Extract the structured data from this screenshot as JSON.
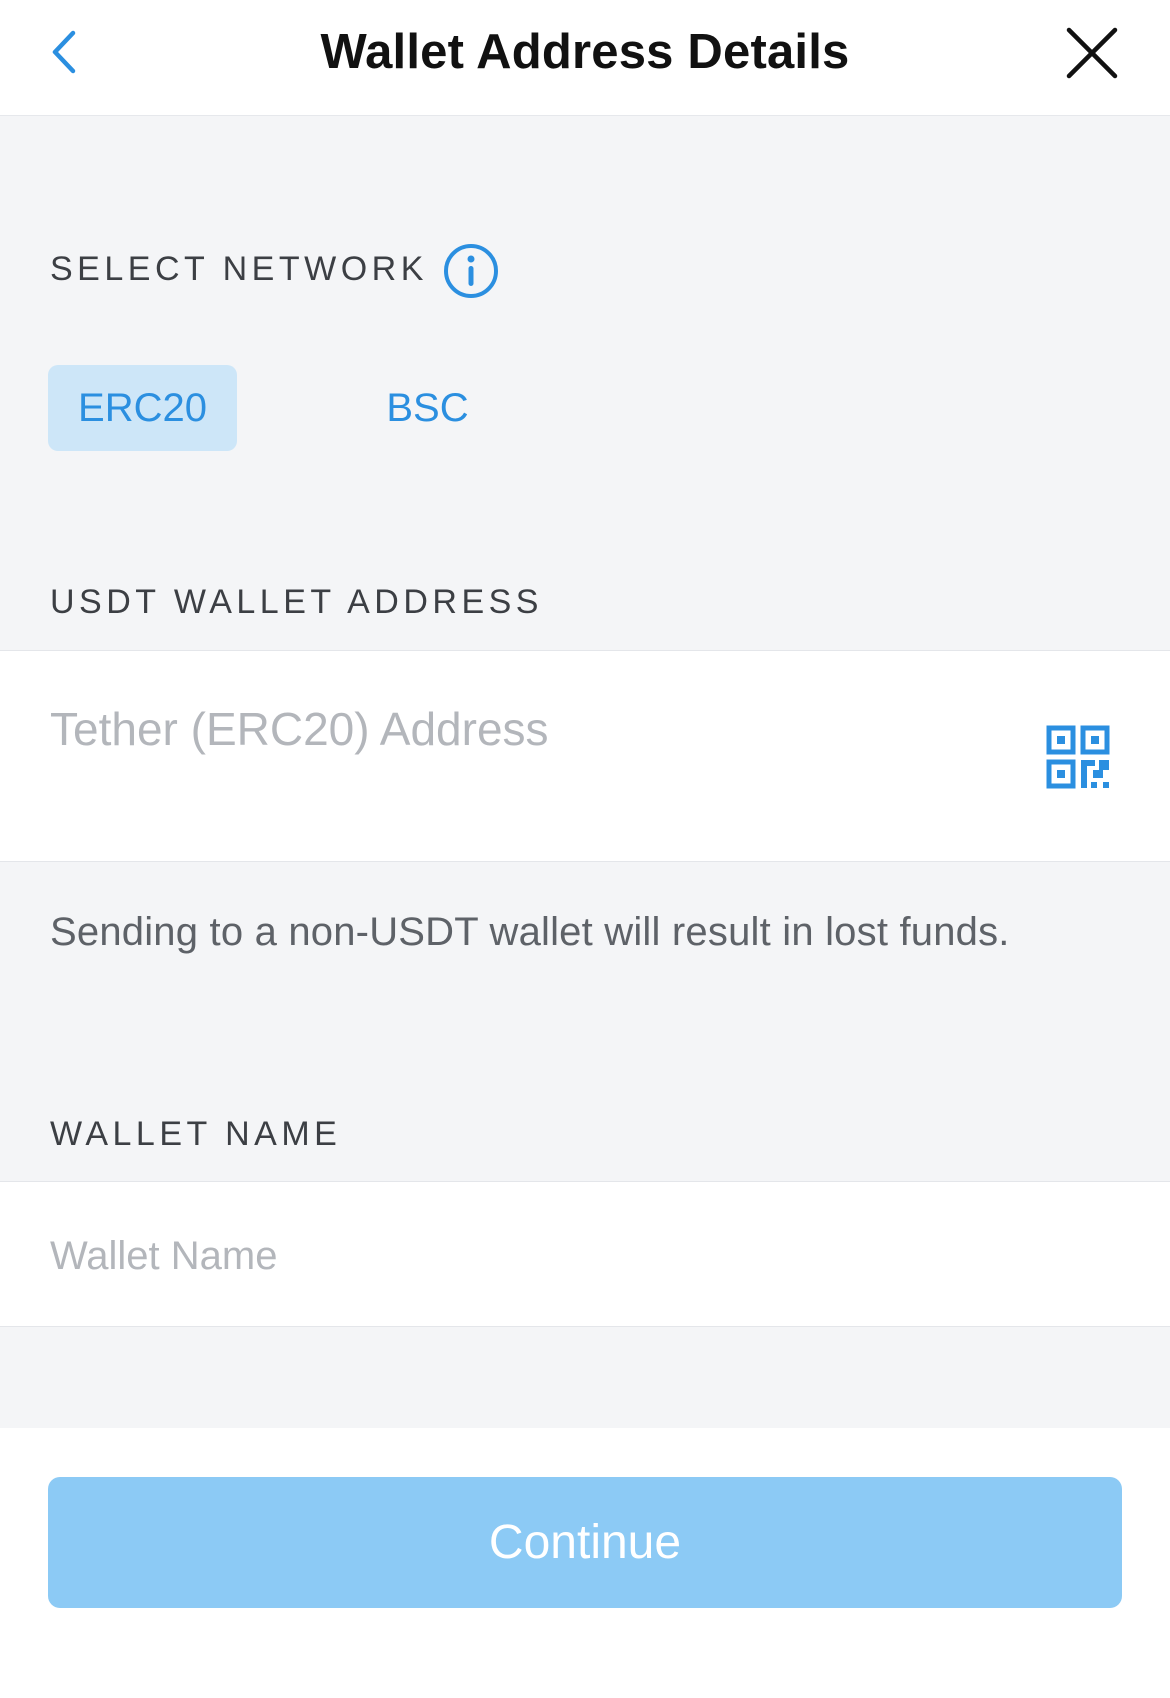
{
  "header": {
    "title": "Wallet Address Details",
    "back_icon": "chevron-left-icon",
    "close_icon": "close-icon"
  },
  "network": {
    "label": "SELECT NETWORK",
    "info_icon": "info-icon",
    "options": [
      {
        "label": "ERC20",
        "selected": true
      },
      {
        "label": "BSC",
        "selected": false
      }
    ]
  },
  "address": {
    "label": "USDT WALLET ADDRESS",
    "value": "",
    "placeholder": "Tether (ERC20) Address",
    "qr_icon": "qr-code-icon",
    "warning": "Sending to a non-USDT wallet will result in lost funds."
  },
  "wallet_name": {
    "label": "WALLET NAME",
    "value": "",
    "placeholder": "Wallet Name"
  },
  "continue_label": "Continue",
  "colors": {
    "accent": "#2B8FE0",
    "selected_tab_bg": "#CDE6F8",
    "button_disabled": "#8CCAF5",
    "background": "#F4F5F7"
  }
}
